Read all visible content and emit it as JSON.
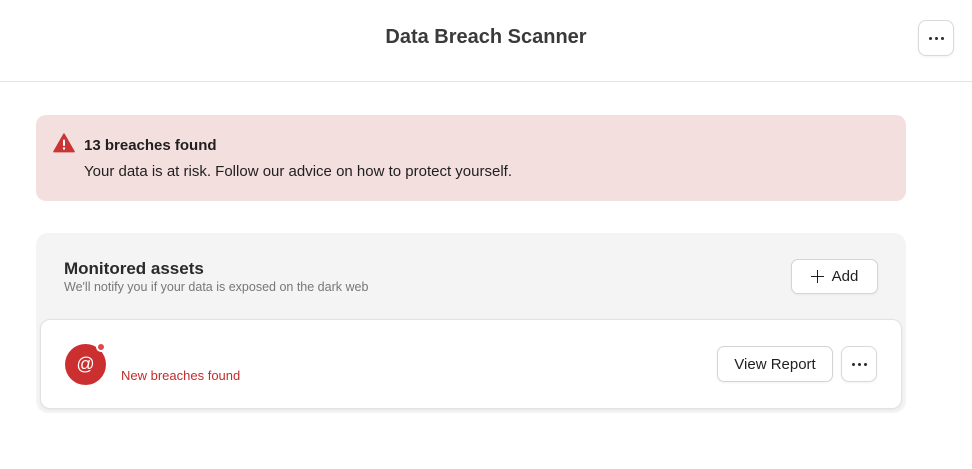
{
  "header": {
    "title": "Data Breach Scanner",
    "menu_icon": "more-horizontal-icon"
  },
  "alert": {
    "icon": "warning-triangle-icon",
    "title": "13 breaches found",
    "message": "Your data is at risk. Follow our advice on how to protect yourself.",
    "color": "#c93434",
    "background": "#f4dfdf"
  },
  "assets": {
    "title": "Monitored assets",
    "subtitle": "We'll notify you if your data is exposed on the dark web",
    "add_label": "Add",
    "add_icon": "plus-icon",
    "items": [
      {
        "icon": "at-sign-icon",
        "avatar_glyph": "@",
        "status": "New breaches found",
        "view_label": "View Report",
        "menu_icon": "more-horizontal-icon",
        "accent": "#cc2f2f"
      }
    ]
  }
}
